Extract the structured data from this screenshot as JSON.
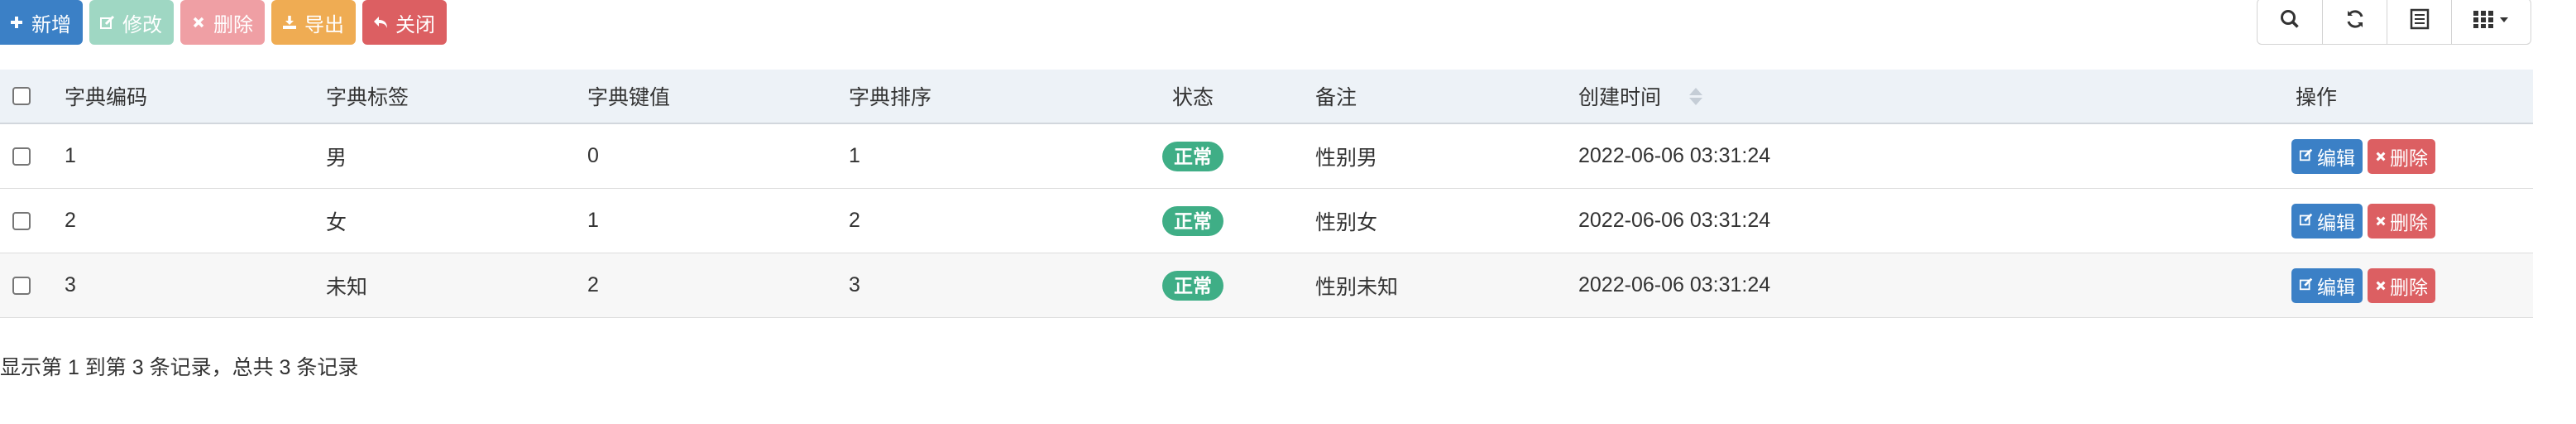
{
  "toolbar": {
    "add_label": "新增",
    "edit_label": "修改",
    "delete_label": "删除",
    "export_label": "导出",
    "close_label": "关闭"
  },
  "table": {
    "headers": {
      "code": "字典编码",
      "label": "字典标签",
      "value": "字典键值",
      "sort": "字典排序",
      "status": "状态",
      "remark": "备注",
      "created": "创建时间",
      "ops": "操作"
    },
    "rows": [
      {
        "code": "1",
        "label": "男",
        "value": "0",
        "sort": "1",
        "status": "正常",
        "remark": "性别男",
        "created": "2022-06-06 03:31:24"
      },
      {
        "code": "2",
        "label": "女",
        "value": "1",
        "sort": "2",
        "status": "正常",
        "remark": "性别女",
        "created": "2022-06-06 03:31:24"
      },
      {
        "code": "3",
        "label": "未知",
        "value": "2",
        "sort": "3",
        "status": "正常",
        "remark": "性别未知",
        "created": "2022-06-06 03:31:24"
      }
    ],
    "row_actions": {
      "edit_label": "编辑",
      "delete_label": "删除"
    }
  },
  "pagination": {
    "summary": "显示第 1 到第 3 条记录，总共 3 条记录"
  },
  "icons": {
    "add": "plus-icon",
    "edit": "edit-icon",
    "delete": "times-icon",
    "export": "download-icon",
    "close": "reply-icon",
    "search": "search-icon",
    "refresh": "refresh-icon",
    "toggle_view": "list-icon",
    "columns": "grid-icon"
  },
  "colors": {
    "primary": "#3b80c6",
    "success_light": "#9fd7c3",
    "danger_light": "#ef9fa4",
    "warning": "#efac53",
    "danger": "#dc5f62",
    "status_badge": "#3fae86",
    "header_bg": "#edf2f7"
  }
}
